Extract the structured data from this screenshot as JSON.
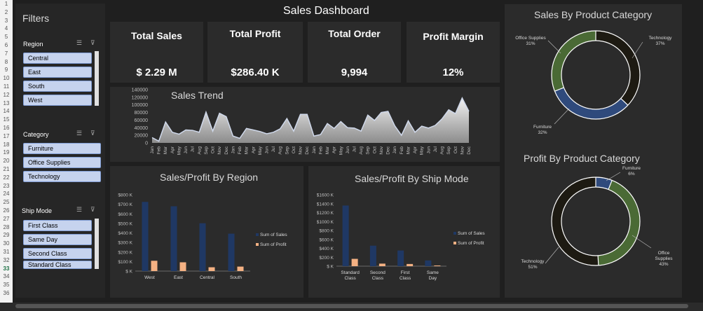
{
  "row_numbers": [
    "1",
    "2",
    "3",
    "4",
    "5",
    "6",
    "7",
    "8",
    "9",
    "10",
    "11",
    "12",
    "13",
    "14",
    "15",
    "16",
    "17",
    "18",
    "19",
    "20",
    "21",
    "22",
    "23",
    "24",
    "25",
    "26",
    "27",
    "28",
    "29",
    "30",
    "31",
    "32",
    "33",
    "34",
    "35",
    "36"
  ],
  "selected_row": "33",
  "dashboard_title": "Sales Dashboard",
  "filters": {
    "title": "Filters",
    "region": {
      "label": "Region",
      "items": [
        "Central",
        "East",
        "South",
        "West"
      ]
    },
    "category": {
      "label": "Category",
      "items": [
        "Furniture",
        "Office Supplies",
        "Technology"
      ]
    },
    "ship_mode": {
      "label": "Ship Mode",
      "items": [
        "First Class",
        "Same Day",
        "Second Class",
        "Standard Class"
      ]
    },
    "multi_select_icon": "multi-select-icon",
    "clear_filter_icon": "clear-filter-icon"
  },
  "kpis": [
    {
      "label": "Total Sales",
      "value": "$ 2.29 M"
    },
    {
      "label": "Total Profit",
      "value": "$286.40 K"
    },
    {
      "label": "Total Order",
      "value": "9,994"
    },
    {
      "label": "Profit Margin",
      "value": "12%"
    }
  ],
  "sales_trend": {
    "title": "Sales Trend",
    "y_ticks": [
      "140000",
      "120000",
      "100000",
      "80000",
      "60000",
      "40000",
      "20000",
      "0"
    ],
    "months": [
      "Jan",
      "Feb",
      "Mar",
      "Apr",
      "May",
      "Jun",
      "Jul",
      "Aug",
      "Sep",
      "Oct",
      "Nov",
      "Dec"
    ],
    "colors": {
      "fill": "#bfbfbf",
      "line": "#cfd8ea"
    }
  },
  "region_chart": {
    "title": "Sales/Profit By Region",
    "y_ticks": [
      "$800 K",
      "$700 K",
      "$600 K",
      "$500 K",
      "$400 K",
      "$300 K",
      "$200 K",
      "$100 K",
      "$ K"
    ],
    "legend": [
      "Sum of Sales",
      "Sum of Profit"
    ],
    "colors": {
      "sales": "#1f3864",
      "profit": "#f4b183"
    }
  },
  "shipmode_chart": {
    "title": "Sales/Profit By Ship Mode",
    "y_ticks": [
      "$1600 K",
      "$1400 K",
      "$1200 K",
      "$1000 K",
      "$800 K",
      "$600 K",
      "$400 K",
      "$200 K",
      "$ K"
    ],
    "legend": [
      "Sum of Sales",
      "Sum of Profit"
    ]
  },
  "category_sales": {
    "title": "Sales By Product Category",
    "labels": [
      {
        "name": "Office Supplies",
        "pct": "31%"
      },
      {
        "name": "Technology",
        "pct": "37%"
      },
      {
        "name": "Furniture",
        "pct": "32%"
      }
    ],
    "colors": {
      "Technology": "#1d1a12",
      "Furniture": "#2f4a7c",
      "Office Supplies": "#4a6a35"
    }
  },
  "category_profit": {
    "title": "Profit By Product Category",
    "labels": [
      {
        "name": "Furniture",
        "pct": "6%"
      },
      {
        "name": "Office Supplies",
        "pct": "43%"
      },
      {
        "name": "Technology",
        "pct": "51%"
      }
    ]
  },
  "chart_data": [
    {
      "type": "area",
      "title": "Sales Trend",
      "x": [
        "Jan",
        "Feb",
        "Mar",
        "Apr",
        "May",
        "Jun",
        "Jul",
        "Aug",
        "Sep",
        "Oct",
        "Nov",
        "Dec",
        "Jan",
        "Feb",
        "Mar",
        "Apr",
        "May",
        "Jun",
        "Jul",
        "Aug",
        "Sep",
        "Oct",
        "Nov",
        "Dec",
        "Jan",
        "Feb",
        "Mar",
        "Apr",
        "May",
        "Jun",
        "Jul",
        "Aug",
        "Sep",
        "Oct",
        "Nov",
        "Dec",
        "Jan",
        "Feb",
        "Mar",
        "Apr",
        "May",
        "Jun",
        "Jul",
        "Aug",
        "Sep",
        "Oct",
        "Nov",
        "Dec"
      ],
      "values": [
        14000,
        4500,
        55000,
        28000,
        23000,
        34000,
        33000,
        28000,
        81000,
        31000,
        78000,
        69000,
        18000,
        12000,
        38000,
        34000,
        30000,
        24000,
        28000,
        37000,
        64000,
        31000,
        75000,
        75000,
        18000,
        22000,
        51000,
        38000,
        56000,
        40000,
        39000,
        31000,
        73000,
        59000,
        80000,
        83000,
        45000,
        20000,
        58000,
        28000,
        44000,
        39000,
        46000,
        63000,
        87000,
        77000,
        118000,
        83000
      ],
      "ylim": [
        0,
        140000
      ]
    },
    {
      "type": "bar",
      "title": "Sales/Profit By Region",
      "categories": [
        "West",
        "East",
        "Central",
        "South"
      ],
      "series": [
        {
          "name": "Sum of Sales",
          "values": [
            725000,
            679000,
            501000,
            392000
          ]
        },
        {
          "name": "Sum of Profit",
          "values": [
            108000,
            92000,
            40000,
            47000
          ]
        }
      ],
      "ylim": [
        0,
        800000
      ]
    },
    {
      "type": "bar",
      "title": "Sales/Profit By Ship Mode",
      "categories": [
        "Standard Class",
        "Second Class",
        "First Class",
        "Same Day"
      ],
      "series": [
        {
          "name": "Sum of Sales",
          "values": [
            1358000,
            459000,
            351000,
            128000
          ]
        },
        {
          "name": "Sum of Profit",
          "values": [
            164000,
            57000,
            49000,
            16000
          ]
        }
      ],
      "ylim": [
        0,
        1600000
      ]
    },
    {
      "type": "pie",
      "title": "Sales By Product Category",
      "categories": [
        "Technology",
        "Furniture",
        "Office Supplies"
      ],
      "values": [
        37,
        32,
        31
      ]
    },
    {
      "type": "pie",
      "title": "Profit By Product Category",
      "categories": [
        "Furniture",
        "Office Supplies",
        "Technology"
      ],
      "values": [
        6,
        43,
        51
      ]
    }
  ]
}
